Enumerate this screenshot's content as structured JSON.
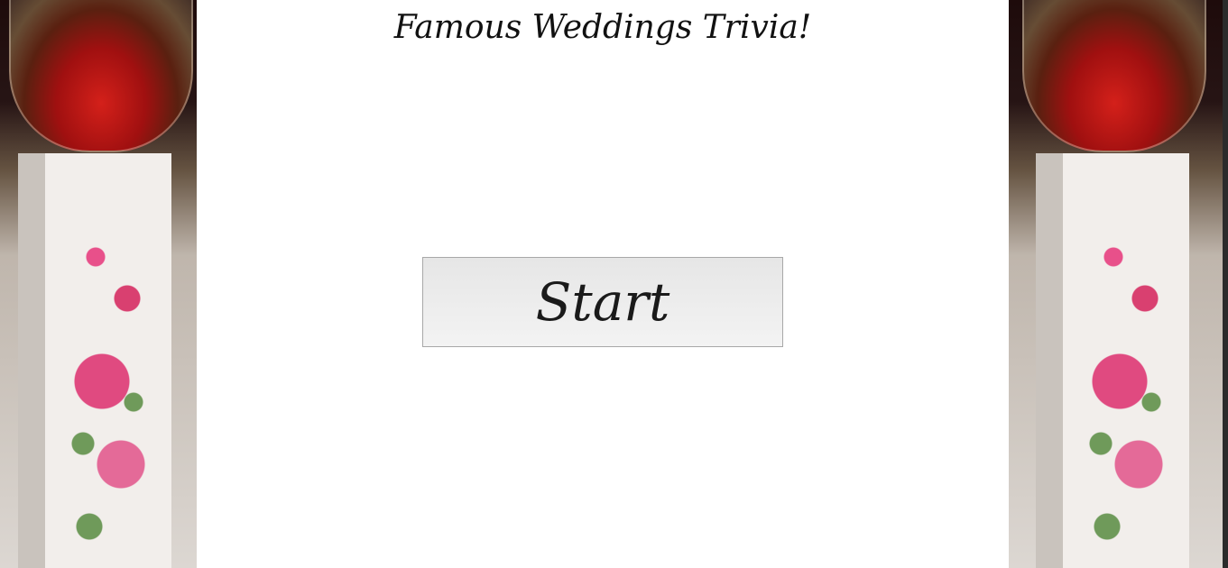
{
  "page": {
    "title": "Famous Weddings Trivia!"
  },
  "actions": {
    "start_label": "Start"
  },
  "colors": {
    "background": "#ffffff",
    "text": "#111111",
    "button_border": "#a8a8a8"
  }
}
